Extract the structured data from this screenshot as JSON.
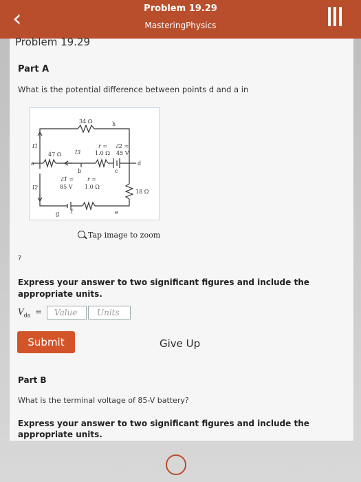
{
  "header": {
    "back_icon": "chevron-left-icon",
    "title": "Problem 19.29",
    "subtitle": "MasteringPhysics",
    "menu_icon": "bars-icon"
  },
  "problem_title": "Problem 19.29",
  "partA": {
    "label": "Part A",
    "question": "What is the potential difference between points d and a in",
    "zoom_text": "Tap image to zoom",
    "help_mark": "?",
    "instructions": "Express your answer to two significant figures and include the appropriate units.",
    "answer_label": "V",
    "answer_sub": "da",
    "equals": "=",
    "value_placeholder": "Value",
    "units_placeholder": "Units",
    "submit_label": "Submit",
    "giveup_label": "Give Up"
  },
  "circuit": {
    "r_top": "34 Ω",
    "node_h": "h",
    "i1": "I1",
    "r_47": "47 Ω",
    "i3": "I3",
    "r_int_top_label": "r =",
    "r_int_top": "1.0 Ω",
    "emf2_label": "ℰ2 =",
    "emf2": "45 V",
    "node_a": "a",
    "node_b": "b",
    "node_c_mid": "c",
    "node_d": "d",
    "r_18": "18 Ω",
    "i2": "I2",
    "emf1_label": "ℰ1 =",
    "emf1": "85 V",
    "r_int_bot_label": "r =",
    "r_int_bot": "1.0 Ω",
    "node_g": "g",
    "node_f": "f",
    "node_e": "e"
  },
  "partB": {
    "label": "Part B",
    "question": "What is the terminal voltage of 85-V battery?",
    "instructions": "Express your answer to two significant figures and include the appropriate units."
  },
  "colors": {
    "header_bg": "#b84e2b",
    "submit_bg": "#d4542a"
  }
}
